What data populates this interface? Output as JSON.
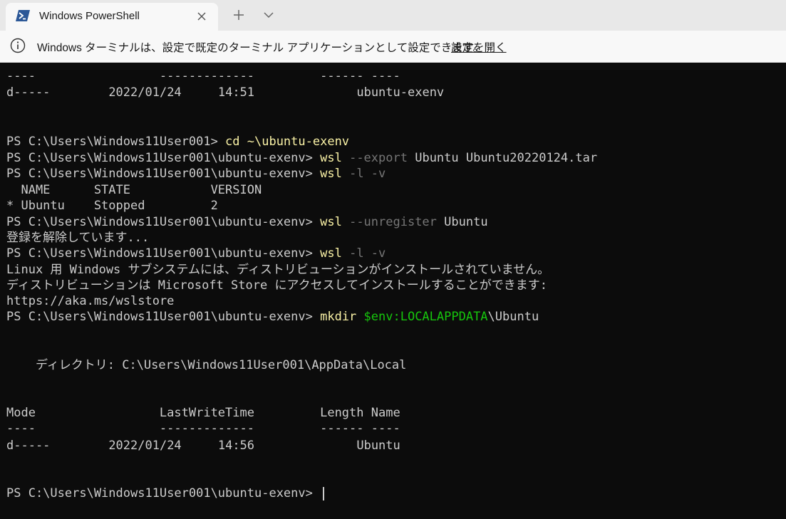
{
  "tabbar": {
    "tab_title": "Windows PowerShell"
  },
  "infobar": {
    "message": "Windows ターミナルは、設定で既定のターミナル アプリケーションとして設定できます。",
    "link": "設定を開く"
  },
  "terminal": {
    "header_dashes": "----                 -------------         ------ ----",
    "row1": {
      "mode": "d-----",
      "date": "2022/01/24",
      "time": "14:51",
      "name": "ubuntu-exenv"
    },
    "prompt1": "PS C:\\Users\\Windows11User001> ",
    "cmd1": "cd ~\\ubuntu-exenv",
    "prompt": "PS C:\\Users\\Windows11User001\\ubuntu-exenv> ",
    "cmd2_wsl": "wsl",
    "cmd2_flag": "--export",
    "cmd2_args": "Ubuntu Ubuntu20220124.tar",
    "cmd3_wsl": "wsl",
    "cmd3_flags": "-l -v",
    "list_header": "  NAME      STATE           VERSION",
    "list_row": "* Ubuntu    Stopped         2",
    "cmd4_wsl": "wsl",
    "cmd4_flag": "--unregister",
    "cmd4_arg": "Ubuntu",
    "unregistering": "登録を解除しています...",
    "cmd5_wsl": "wsl",
    "cmd5_flags": "-l -v",
    "no_dist_line1": "Linux 用 Windows サブシステムには、ディストリビューションがインストールされていません。",
    "no_dist_line2": "ディストリビューションは Microsoft Store にアクセスしてインストールすることができます:",
    "store_url": "https://aka.ms/wslstore",
    "cmd6_mkdir": "mkdir",
    "cmd6_var": "$env:LOCALAPPDATA",
    "cmd6_rest": "\\Ubuntu",
    "directory_line": "    ディレクトリ: C:\\Users\\Windows11User001\\AppData\\Local",
    "table_header": "Mode                 LastWriteTime         Length Name",
    "table_dashes": "----                 -------------         ------ ----",
    "row2": {
      "mode": "d-----",
      "date": "2022/01/24",
      "time": "14:56",
      "name": "Ubuntu"
    },
    "final_prompt": "PS C:\\Users\\Windows11User001\\ubuntu-exenv> "
  }
}
